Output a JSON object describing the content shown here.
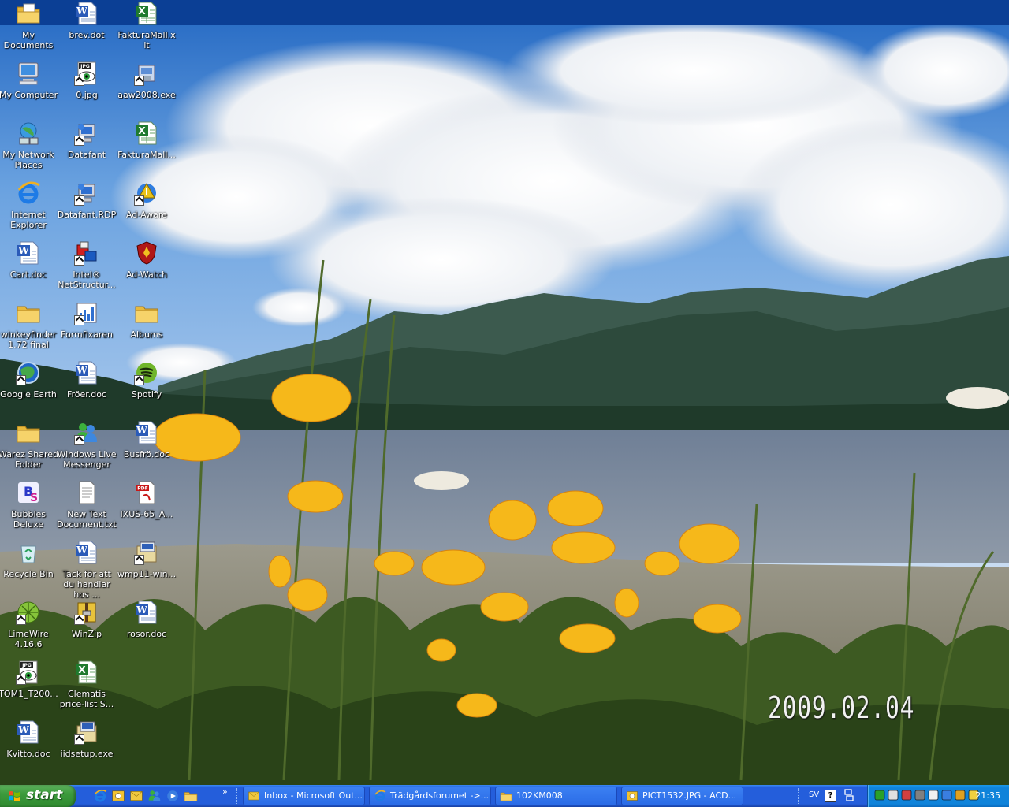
{
  "desktop": {
    "date_stamp": "2009.02.04",
    "icons": [
      {
        "label": "My Documents",
        "icon": "folder-docs-icon",
        "col": 0,
        "row": 0
      },
      {
        "label": "brev.dot",
        "icon": "word-doc-icon",
        "col": 1,
        "row": 0
      },
      {
        "label": "FakturaMall.xlt",
        "icon": "excel-icon",
        "col": 2,
        "row": 0
      },
      {
        "label": "My Computer",
        "icon": "computer-icon",
        "col": 0,
        "row": 1
      },
      {
        "label": "0.jpg",
        "icon": "jpg-viewer-icon",
        "col": 1,
        "row": 1
      },
      {
        "label": "aaw2008.exe",
        "icon": "installer-icon",
        "col": 2,
        "row": 1
      },
      {
        "label": "My Network Places",
        "icon": "network-icon",
        "col": 0,
        "row": 2
      },
      {
        "label": "Datafant",
        "icon": "remote-desktop-icon",
        "col": 1,
        "row": 2
      },
      {
        "label": "FakturaMall...",
        "icon": "excel-icon",
        "col": 2,
        "row": 2
      },
      {
        "label": "Internet Explorer",
        "icon": "ie-icon",
        "col": 0,
        "row": 3
      },
      {
        "label": "Datafant.RDP",
        "icon": "remote-desktop-icon",
        "col": 1,
        "row": 3
      },
      {
        "label": "Ad-Aware",
        "icon": "adaware-icon",
        "col": 2,
        "row": 3
      },
      {
        "label": "Cart.doc",
        "icon": "word-doc-icon",
        "col": 0,
        "row": 4
      },
      {
        "label": "Intel® NetStructur...",
        "icon": "intel-icon",
        "col": 1,
        "row": 4
      },
      {
        "label": "Ad-Watch",
        "icon": "shield-icon",
        "col": 2,
        "row": 4
      },
      {
        "label": "winkeyfinder 1.72 final",
        "icon": "folder-icon",
        "col": 0,
        "row": 5
      },
      {
        "label": "Formfixaren",
        "icon": "chart-app-icon",
        "col": 1,
        "row": 5
      },
      {
        "label": "Albums",
        "icon": "folder-icon",
        "col": 2,
        "row": 5
      },
      {
        "label": "Google Earth",
        "icon": "globe-icon",
        "col": 0,
        "row": 6
      },
      {
        "label": "Fröer.doc",
        "icon": "word-doc-icon",
        "col": 1,
        "row": 6
      },
      {
        "label": "Spotify",
        "icon": "spotify-icon",
        "col": 2,
        "row": 6
      },
      {
        "label": "Warez Shared Folder",
        "icon": "folder-icon",
        "col": 0,
        "row": 7
      },
      {
        "label": "Windows Live Messenger",
        "icon": "messenger-icon",
        "col": 1,
        "row": 7
      },
      {
        "label": "Busfrö.doc",
        "icon": "word-doc-icon",
        "col": 2,
        "row": 7
      },
      {
        "label": "Bubbles Deluxe",
        "icon": "bubbles-icon",
        "col": 0,
        "row": 8
      },
      {
        "label": "New Text Document.txt",
        "icon": "text-file-icon",
        "col": 1,
        "row": 8
      },
      {
        "label": "IXUS-65_A...",
        "icon": "pdf-icon",
        "col": 2,
        "row": 8
      },
      {
        "label": "Recycle Bin",
        "icon": "recycle-bin-icon",
        "col": 0,
        "row": 9
      },
      {
        "label": "Tack för att du handlar hos ...",
        "icon": "word-doc-icon",
        "col": 1,
        "row": 9
      },
      {
        "label": "wmp11-win...",
        "icon": "setup-icon",
        "col": 2,
        "row": 9
      },
      {
        "label": "LimeWire 4.16.6",
        "icon": "limewire-icon",
        "col": 0,
        "row": 10
      },
      {
        "label": "WinZip",
        "icon": "winzip-icon",
        "col": 1,
        "row": 10
      },
      {
        "label": "rosor.doc",
        "icon": "word-doc-icon",
        "col": 2,
        "row": 10
      },
      {
        "label": "TOM1_T200...",
        "icon": "jpg-viewer-icon",
        "col": 0,
        "row": 11
      },
      {
        "label": "Clematis price-list S...",
        "icon": "excel-icon",
        "col": 1,
        "row": 11
      },
      {
        "label": "Kvitto.doc",
        "icon": "word-doc-icon",
        "col": 0,
        "row": 12
      },
      {
        "label": "iidsetup.exe",
        "icon": "setup-icon",
        "col": 1,
        "row": 12
      }
    ]
  },
  "taskbar": {
    "start_label": "start",
    "quick_launch": [
      "ie-icon",
      "acdsee-icon",
      "outlook-icon",
      "messenger-icon",
      "windows-media-icon",
      "folder-icon"
    ],
    "quick_launch_overflow": "»",
    "tasks": [
      {
        "label": "Inbox - Microsoft Out...",
        "icon": "outlook-icon"
      },
      {
        "label": "Trädgårdsforumet ->...",
        "icon": "ie-icon"
      },
      {
        "label": "102KM008",
        "icon": "folder-icon"
      },
      {
        "label": "PICT1532.JPG - ACD...",
        "icon": "acdsee-icon"
      }
    ],
    "language": "SV",
    "help": "?",
    "tray_icons": [
      "msn-m-icon",
      "network-icon",
      "security-icon",
      "volume-icon",
      "monitor-icon",
      "update-icon",
      "winamp-icon",
      "pencil-icon"
    ],
    "clock": "21:35"
  },
  "colors": {
    "taskbar": "#245edb",
    "start": "#3c9a3c",
    "tray": "#0f83da"
  }
}
